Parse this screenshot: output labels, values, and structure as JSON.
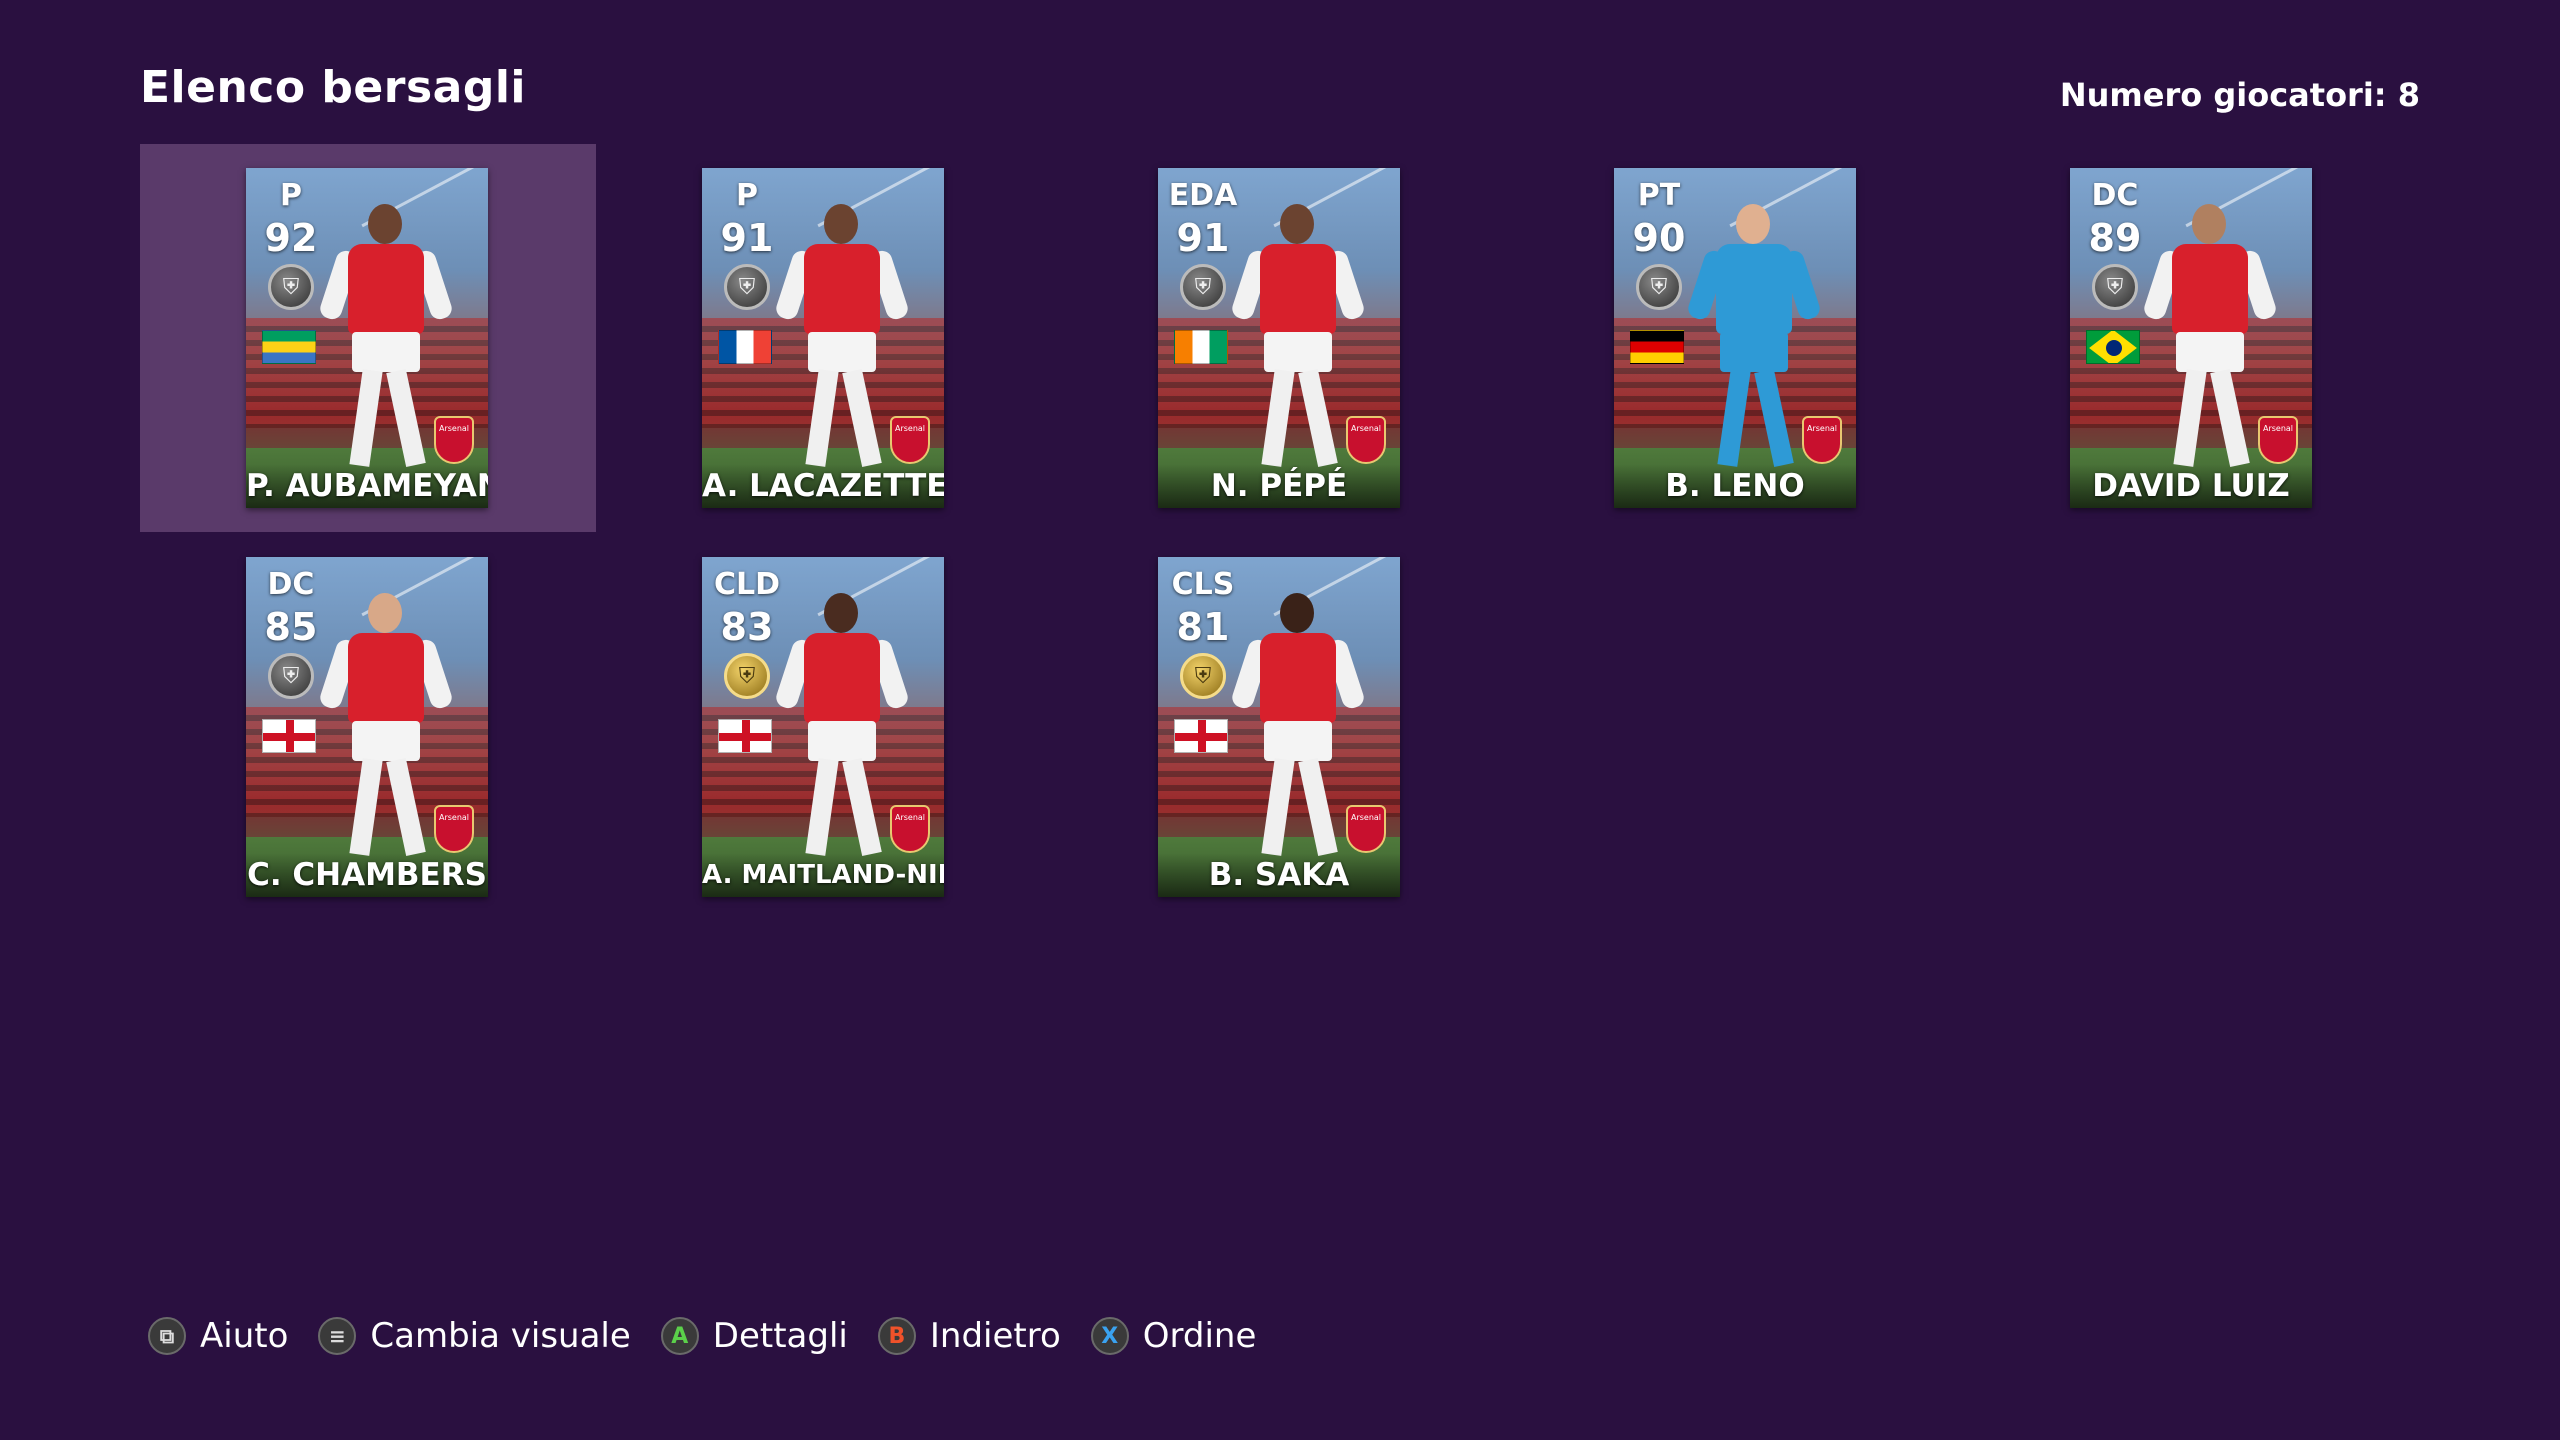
{
  "header": {
    "title": "Elenco bersagli",
    "player_count": "Numero giocatori: 8"
  },
  "colors": {
    "background": "#2a1040",
    "selected_slot": "#5a3a6a",
    "shirt_red": "#d8202c",
    "gk_blue": "#2e9ad6"
  },
  "players": [
    {
      "position": "P",
      "rating": "92",
      "name": "P. AUBAMEYANG",
      "flag": "gabon-flag",
      "medal": "silver-medal-icon",
      "crest": "Arsenal",
      "selected": true
    },
    {
      "position": "P",
      "rating": "91",
      "name": "A. LACAZETTE",
      "flag": "france-flag",
      "medal": "silver-medal-icon",
      "crest": "Arsenal"
    },
    {
      "position": "EDA",
      "rating": "91",
      "name": "N. PÉPÉ",
      "flag": "ivory-coast-flag",
      "medal": "silver-medal-icon",
      "crest": "Arsenal"
    },
    {
      "position": "PT",
      "rating": "90",
      "name": "B. LENO",
      "flag": "germany-flag",
      "medal": "silver-medal-icon",
      "crest": "Arsenal"
    },
    {
      "position": "DC",
      "rating": "89",
      "name": "DAVID LUIZ",
      "flag": "brazil-flag",
      "medal": "silver-medal-icon",
      "crest": "Arsenal"
    },
    {
      "position": "DC",
      "rating": "85",
      "name": "C. CHAMBERS",
      "flag": "england-flag",
      "medal": "silver-medal-icon",
      "crest": "Arsenal"
    },
    {
      "position": "CLD",
      "rating": "83",
      "name": "A. MAITLAND-NILES",
      "flag": "england-flag",
      "medal": "gold-medal-icon",
      "crest": "Arsenal"
    },
    {
      "position": "CLS",
      "rating": "81",
      "name": "B. SAKA",
      "flag": "england-flag",
      "medal": "gold-medal-icon",
      "crest": "Arsenal"
    }
  ],
  "footer": {
    "hints": [
      {
        "button": "view-button-icon",
        "glyph": "⧉",
        "label": "Aiuto"
      },
      {
        "button": "menu-button-icon",
        "glyph": "≡",
        "label": "Cambia visuale"
      },
      {
        "button": "a-button-icon",
        "glyph": "A",
        "label": "Dettagli"
      },
      {
        "button": "b-button-icon",
        "glyph": "B",
        "label": "Indietro"
      },
      {
        "button": "x-button-icon",
        "glyph": "X",
        "label": "Ordine"
      }
    ]
  }
}
